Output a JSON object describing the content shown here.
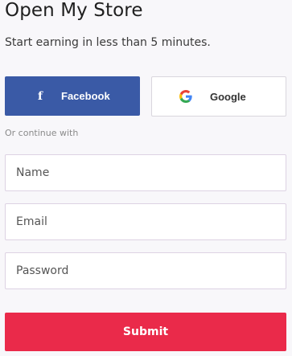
{
  "header": {
    "title": "Open My Store",
    "subtitle": "Start earning in less than 5 minutes."
  },
  "social": {
    "facebook_label": "Facebook",
    "facebook_icon": "facebook-f-icon",
    "facebook_color": "#3a5aa6",
    "google_label": "Google",
    "google_icon": "google-g-icon"
  },
  "divider": {
    "text": "Or continue with"
  },
  "form": {
    "name_placeholder": "Name",
    "email_placeholder": "Email",
    "password_placeholder": "Password",
    "submit_label": "Submit",
    "submit_color": "#ea2a4a"
  }
}
